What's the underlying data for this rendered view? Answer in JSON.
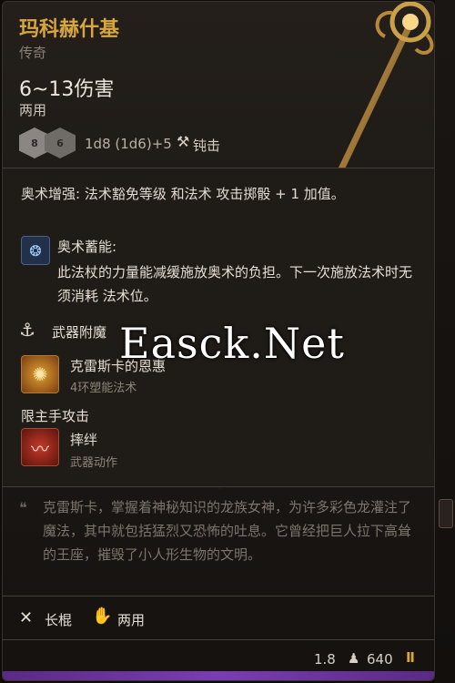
{
  "item": {
    "title": "玛科赫什基",
    "rarity": "传奇",
    "damage": "6~13伤害",
    "handedness": "两用",
    "dice": [
      "8",
      "6"
    ],
    "dice_formula": "1d8 (1d6)+5",
    "damage_type": "钝击"
  },
  "effects": {
    "arcane_enhancement": "奥术增强: 法术豁免等级 和法术 攻击掷骰 + 1 加值。",
    "arcane_charge_title": "奥术蓄能:",
    "arcane_charge_desc": "此法杖的力量能减缓施放奥术的负担。下一次施放法术时无须消耗 法术位。",
    "weapon_enchant_label": "武器附魔",
    "spell_name": "克雷斯卡的恩惠",
    "spell_sub": "4环塑能法术",
    "mainhand_label": "限主手攻击",
    "action_name": "摔绊",
    "action_sub": "武器动作"
  },
  "lore": "克雷斯卡，掌握着神秘知识的龙族女神，为许多彩色龙灌注了魔法，其中就包括猛烈又恐怖的吐息。它曾经把巨人拉下高耸的王座，摧毁了小人形生物的文明。",
  "proficiency": {
    "type_label": "长棍",
    "hand_label": "两用"
  },
  "footer": {
    "weight": "1.8",
    "gold": "640"
  },
  "watermark": "Easck.Net",
  "icons": {
    "hammer": "hammer-icon",
    "arcane": "arcane-icon",
    "enchant": "anchor-icon",
    "spell": "sun-spell-icon",
    "action": "trip-action-icon",
    "quote": "quote-icon",
    "staff": "staff-icon",
    "hand": "hand-icon",
    "person": "person-icon",
    "gold": "gold-icon"
  },
  "colors": {
    "title": "#d7a640",
    "rarity_edge": "#7b3cb3",
    "panel": "#1f1b17"
  }
}
